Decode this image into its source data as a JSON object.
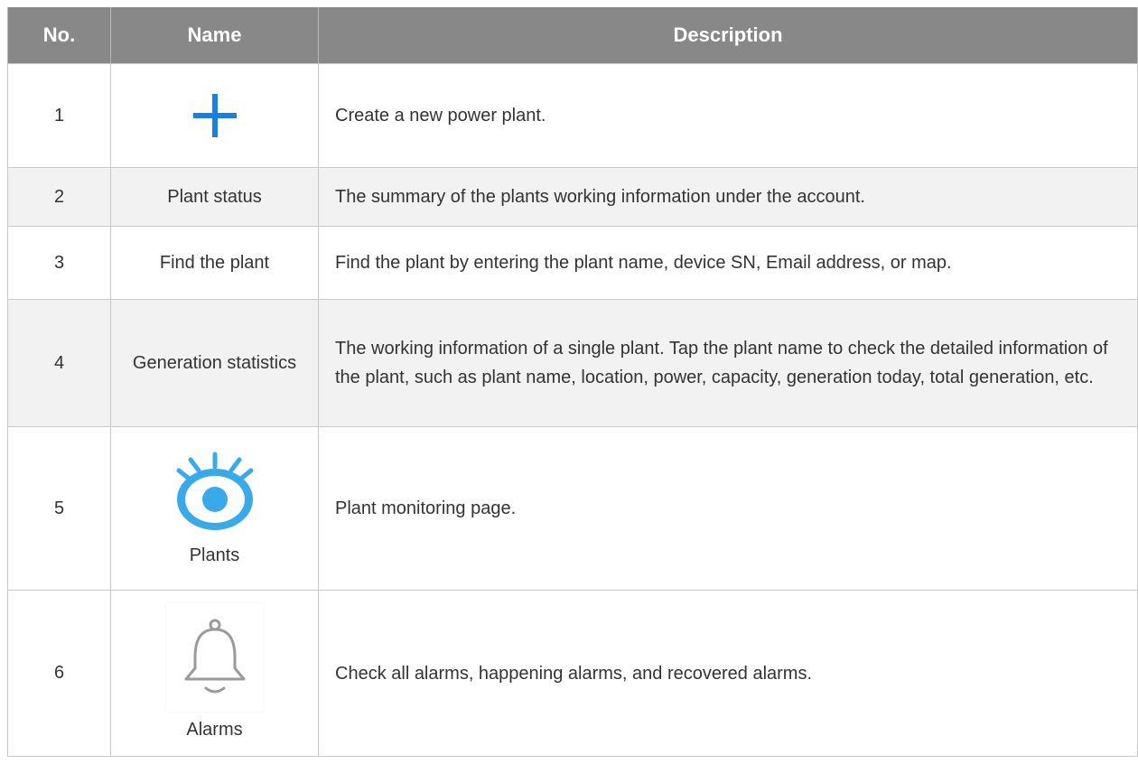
{
  "table": {
    "headers": {
      "no": "No.",
      "name": "Name",
      "description": "Description"
    },
    "rows": [
      {
        "no": "1",
        "name": "",
        "icon": "plus-icon",
        "description": "Create a new power plant."
      },
      {
        "no": "2",
        "name": "Plant status",
        "description": "The summary of the plants working information under the account."
      },
      {
        "no": "3",
        "name": "Find the plant",
        "description": "Find the plant by entering the plant name, device SN, Email address, or map."
      },
      {
        "no": "4",
        "name": "Generation statistics",
        "description": "The working information of a single plant. Tap the plant name to check the detailed information of the plant, such as plant name, location, power, capacity, generation today, total generation, etc."
      },
      {
        "no": "5",
        "name": "Plants",
        "icon": "eye-icon",
        "description": "Plant monitoring page."
      },
      {
        "no": "6",
        "name": "Alarms",
        "icon": "bell-icon",
        "description": "Check all alarms, happening alarms, and recovered alarms."
      }
    ]
  },
  "colors": {
    "header_bg": "#888888",
    "header_text": "#ffffff",
    "alt_row_bg": "#f2f2f2",
    "plus_icon": "#1a7fe0",
    "eye_icon": "#3aa9ea",
    "bell_icon": "#9a9a9a"
  }
}
